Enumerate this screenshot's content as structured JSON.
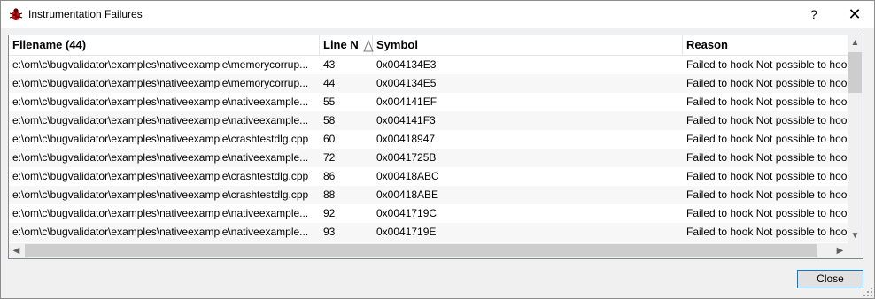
{
  "window": {
    "title": "Instrumentation Failures",
    "help_label": "?",
    "close_glyph": "✕"
  },
  "table": {
    "columns": [
      "Filename (44)",
      "Line N",
      "Symbol",
      "Reason"
    ],
    "sorted_column": "Line N",
    "sort_direction": "ascending",
    "rows": [
      {
        "filename": "e:\\om\\c\\bugvalidator\\examples\\nativeexample\\memorycorrup...",
        "line": "43",
        "symbol": "0x004134E3",
        "reason": "Failed to hook Not possible to hoo"
      },
      {
        "filename": "e:\\om\\c\\bugvalidator\\examples\\nativeexample\\memorycorrup...",
        "line": "44",
        "symbol": "0x004134E5",
        "reason": "Failed to hook Not possible to hoo"
      },
      {
        "filename": "e:\\om\\c\\bugvalidator\\examples\\nativeexample\\nativeexample...",
        "line": "55",
        "symbol": "0x004141EF",
        "reason": "Failed to hook Not possible to hoo"
      },
      {
        "filename": "e:\\om\\c\\bugvalidator\\examples\\nativeexample\\nativeexample...",
        "line": "58",
        "symbol": "0x004141F3",
        "reason": "Failed to hook Not possible to hoo"
      },
      {
        "filename": "e:\\om\\c\\bugvalidator\\examples\\nativeexample\\crashtestdlg.cpp",
        "line": "60",
        "symbol": "0x00418947",
        "reason": "Failed to hook Not possible to hoo"
      },
      {
        "filename": "e:\\om\\c\\bugvalidator\\examples\\nativeexample\\nativeexample...",
        "line": "72",
        "symbol": "0x0041725B",
        "reason": "Failed to hook Not possible to hoo"
      },
      {
        "filename": "e:\\om\\c\\bugvalidator\\examples\\nativeexample\\crashtestdlg.cpp",
        "line": "86",
        "symbol": "0x00418ABC",
        "reason": "Failed to hook Not possible to hoo"
      },
      {
        "filename": "e:\\om\\c\\bugvalidator\\examples\\nativeexample\\crashtestdlg.cpp",
        "line": "88",
        "symbol": "0x00418ABE",
        "reason": "Failed to hook Not possible to hoo"
      },
      {
        "filename": "e:\\om\\c\\bugvalidator\\examples\\nativeexample\\nativeexample...",
        "line": "92",
        "symbol": "0x0041719C",
        "reason": "Failed to hook Not possible to hoo"
      },
      {
        "filename": "e:\\om\\c\\bugvalidator\\examples\\nativeexample\\nativeexample...",
        "line": "93",
        "symbol": "0x0041719E",
        "reason": "Failed to hook Not possible to hoo"
      }
    ]
  },
  "scrollbars": {
    "vertical_up": "▲",
    "vertical_down": "▼",
    "horizontal_left": "◀",
    "horizontal_right": "▶"
  },
  "footer": {
    "close_label": "Close"
  },
  "icons": {
    "app_icon": "bug-icon",
    "sort_icon": "sort-ascending-icon"
  },
  "colors": {
    "accent": "#0078d7",
    "bug_red": "#d01010"
  }
}
